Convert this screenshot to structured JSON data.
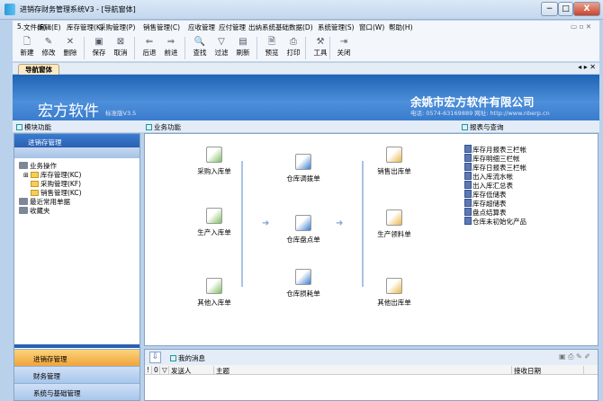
{
  "window": {
    "title": "进销存财务管理系统V3 - [导航窗体]",
    "minimize": "−",
    "maximize": "□",
    "close": "X"
  },
  "menu": [
    "文件(F)",
    "编辑(E)",
    "库存管理(K)",
    "采购管理(P)",
    "销售管理(C)",
    "应收管理",
    "应付管理",
    "出纳系统",
    "基础数据(D)",
    "系统管理(S)",
    "窗口(W)",
    "帮助(H)"
  ],
  "toolbar": [
    {
      "label": "新建",
      "icon": "new-icon",
      "glyph": "🗋"
    },
    {
      "label": "修改",
      "icon": "edit-icon",
      "glyph": "✎"
    },
    {
      "label": "删除",
      "icon": "delete-icon",
      "glyph": "✕"
    },
    {
      "label": "保存",
      "icon": "save-icon",
      "glyph": "▣"
    },
    {
      "label": "取消",
      "icon": "cancel-icon",
      "glyph": "⊠"
    },
    {
      "label": "后退",
      "icon": "back-icon",
      "glyph": "⇐"
    },
    {
      "label": "前进",
      "icon": "forward-icon",
      "glyph": "⇒"
    },
    {
      "label": "查找",
      "icon": "find-icon",
      "glyph": "🔍"
    },
    {
      "label": "过滤",
      "icon": "filter-icon",
      "glyph": "▽"
    },
    {
      "label": "刷新",
      "icon": "refresh-icon",
      "glyph": "▤"
    },
    {
      "label": "预览",
      "icon": "preview-icon",
      "glyph": "🗎"
    },
    {
      "label": "打印",
      "icon": "print-icon",
      "glyph": "⎙"
    },
    {
      "label": "工具",
      "icon": "tools-icon",
      "glyph": "⚒"
    },
    {
      "label": "关闭",
      "icon": "exit-icon",
      "glyph": "⇥"
    }
  ],
  "tab": "导航窗体",
  "banner": {
    "brand": "宏方软件",
    "edition": "标准版V3.5",
    "company": "余姚市宏方软件有限公司",
    "contact": "电话: 0574-63169889    网址: http://www.nberp.cn"
  },
  "sections": {
    "modules": "模块功能",
    "business": "业务功能",
    "reports": "报表与查询"
  },
  "left": {
    "header": "进销存管理",
    "tree": [
      {
        "label": "业务操作",
        "type": "pc"
      },
      {
        "label": "库存管理(KC)",
        "type": "folder"
      },
      {
        "label": "采购管理(KF)",
        "type": "folder"
      },
      {
        "label": "销售管理(KC)",
        "type": "folder"
      },
      {
        "label": "最近常用单据",
        "type": "pc"
      },
      {
        "label": "收藏夹",
        "type": "pc"
      }
    ],
    "nav": [
      "进销存管理",
      "财务管理",
      "系统与基础管理"
    ]
  },
  "workflow": {
    "in": [
      "采购入库单",
      "生产入库单",
      "其他入库单"
    ],
    "mid": [
      "仓库调拨单",
      "仓库盘点单",
      "仓库损耗单"
    ],
    "out": [
      "销售出库单",
      "生产领料单",
      "其他出库单"
    ]
  },
  "reports": [
    "库存月报表三栏帐",
    "库存明细三栏帐",
    "库存日报表三栏帐",
    "出入库流水帐",
    "出入库汇总表",
    "库存低储表",
    "库存超储表",
    "盘点结算表",
    "仓库未初始化产品"
  ],
  "messages": {
    "title": "我的消息",
    "columns": [
      "!",
      "0",
      "▽",
      "发送人",
      "主题",
      "接收日期"
    ]
  }
}
